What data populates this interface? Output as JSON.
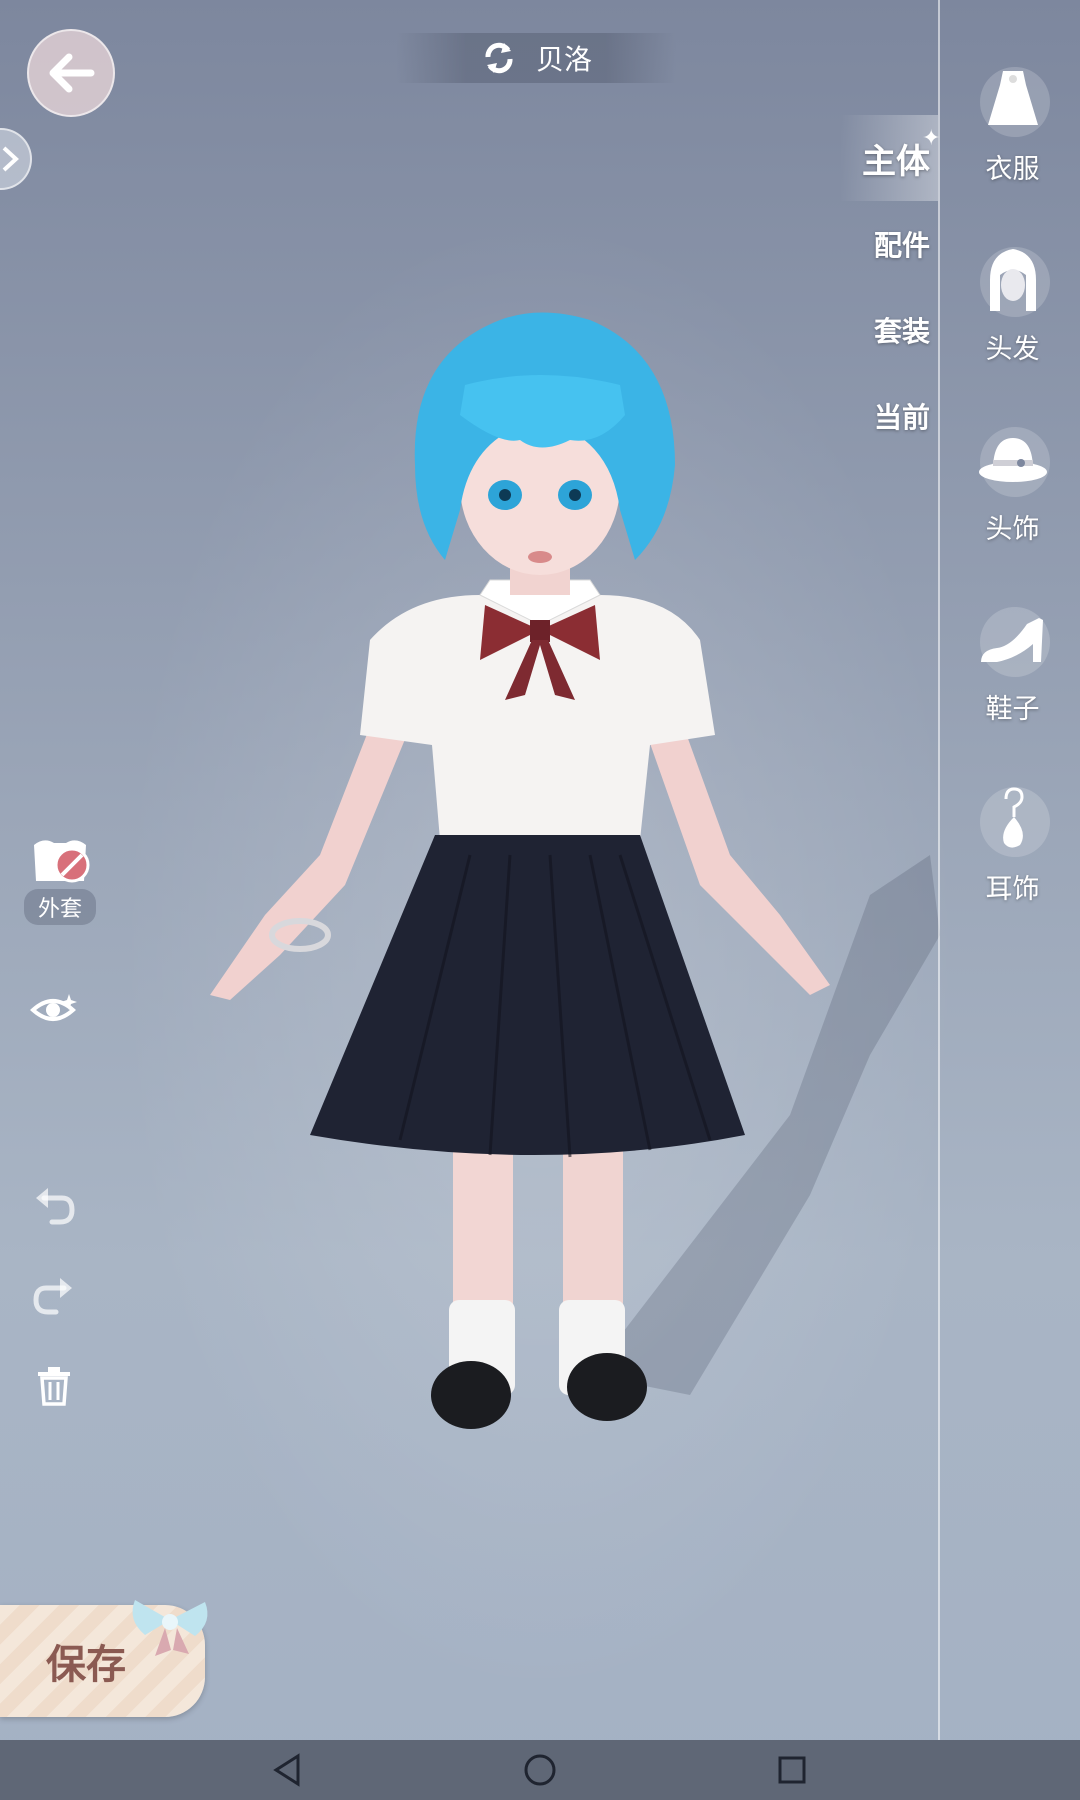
{
  "header": {
    "title": "贝洛"
  },
  "category_tabs": [
    {
      "label": "主体",
      "active": true
    },
    {
      "label": "配件",
      "active": false
    },
    {
      "label": "套装",
      "active": false
    },
    {
      "label": "当前",
      "active": false
    }
  ],
  "sidebar": {
    "items": [
      {
        "label": "衣服",
        "icon": "dress-icon"
      },
      {
        "label": "头发",
        "icon": "hair-icon"
      },
      {
        "label": "头饰",
        "icon": "hat-icon"
      },
      {
        "label": "鞋子",
        "icon": "shoe-icon"
      },
      {
        "label": "耳饰",
        "icon": "earring-icon"
      }
    ]
  },
  "left_tools": {
    "coat_label": "外套",
    "coat_state": "hidden"
  },
  "save": {
    "label": "保存"
  },
  "colors": {
    "background": "#9ba6b8",
    "hair": "#3bb4e6",
    "save_text": "#8b5a52",
    "navbar": "#5f6776"
  }
}
